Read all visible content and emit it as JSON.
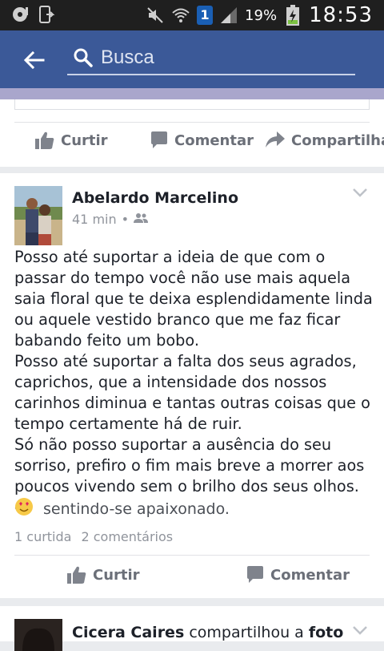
{
  "status_bar": {
    "notification_count": "1",
    "battery_percent": "19%",
    "time": "18:53",
    "icons": [
      "vinyl-icon",
      "phone-sync-icon",
      "mute-icon",
      "wifi-icon",
      "signal-icon",
      "battery-charging-icon"
    ]
  },
  "header": {
    "search_placeholder": "Busca",
    "back_icon": "arrow-left-icon",
    "search_icon": "magnifier-icon",
    "colors": {
      "bar": "#3b5998",
      "strip": "#a9a6cc"
    }
  },
  "previous_post": {
    "actions": {
      "like": "Curtir",
      "comment": "Comentar",
      "share": "Compartilhar"
    }
  },
  "post": {
    "author": "Abelardo Marcelino",
    "time": "41 min",
    "separator": "•",
    "audience_icon": "friends-icon",
    "text": "Posso até suportar a ideia de que com o\npassar do tempo você não use mais aquela\nsaia floral que te deixa esplendidamente linda\nou aquele vestido branco que me faz ficar\nbabando feito um bobo.\nPosso até suportar a falta dos seus agrados,\ncaprichos, que a intensidade dos nossos\ncarinhos diminua e tantas outras coisas que o\ntempo certamente há de ruir.\nSó não posso suportar a ausência do seu\nsorriso, prefiro o fim mais breve a morrer aos\npoucos vivendo sem o brilho dos seus olhos. —",
    "feeling_emoji": "in-love-emoji",
    "feeling": "sentindo-se apaixonado.",
    "likes": "1 curtida",
    "comments": "2 comentários",
    "actions": {
      "like": "Curtir",
      "comment": "Comentar"
    }
  },
  "next_post": {
    "author": "Cicera Caires",
    "verb": "compartilhou a",
    "object": "foto"
  }
}
